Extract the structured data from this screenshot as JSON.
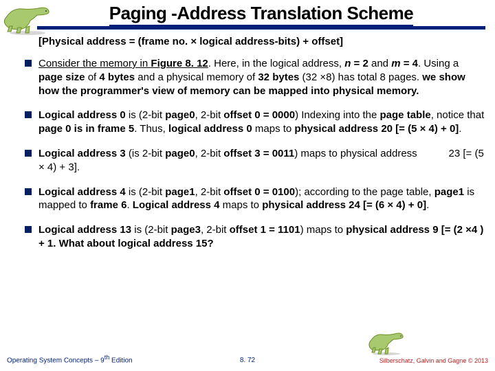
{
  "title": "Paging -Address Translation Scheme",
  "subhead": "[Physical address = (frame no. × logical address-bits) + offset]",
  "bullets": [
    "<u>Consider the memory in <b>Figure 8. 12</b></u>. Here, in the logical address, <b><i>n</i> = 2</b> and <b><i>m</i> = 4</b>. Using a <b>page size</b> of <b>4 bytes</b> and a physical memory of <b>32 bytes</b> (32 ×8) has  total 8 pages. <b>we show how the programmer's view of memory can be mapped into physical memory.</b>",
    "<b>Logical address 0</b> is (2-bit <b>page0</b>, 2-bit <b>offset 0 = 0000</b>) Indexing into the <b>page table</b>, notice that <b>page 0 is in frame 5</b>. Thus, <b>logical address 0</b> maps to <b>physical address 20 [= (5 × 4) + 0]</b>.",
    "<b>Logical address 3</b> (is 2-bit <b>page0</b>, 2-bit <b>offset 3 = 0011</b>) maps to physical address &nbsp;&nbsp;&nbsp;&nbsp;&nbsp;&nbsp;&nbsp;&nbsp;&nbsp;&nbsp;23 [= (5 × 4) + 3].",
    "<b>Logical address 4</b> is (2-bit <b>page1</b>, 2-bit <b>offset 0 = 0100</b>); according to the page table, <b>page1</b> is mapped to <b>frame 6</b>. <b>Logical address 4</b> maps to <b>physical address 24 [= (6 × 4) + 0]</b>.",
    "<b>Logical address 13</b>  is (2-bit <b>page3</b>, 2-bit <b>offset 1 = 1101</b>) maps to <b>physical address 9 [= (2 ×4 ) + 1. What about logical address 15?</b>"
  ],
  "footer": {
    "left_a": "Operating System Concepts – 9",
    "left_b": " Edition",
    "left_sup": "th",
    "center": "8. 72",
    "right_a": "Silberschatz, Galvin and Gagne ",
    "right_b": " 2013",
    "copy": "©"
  }
}
